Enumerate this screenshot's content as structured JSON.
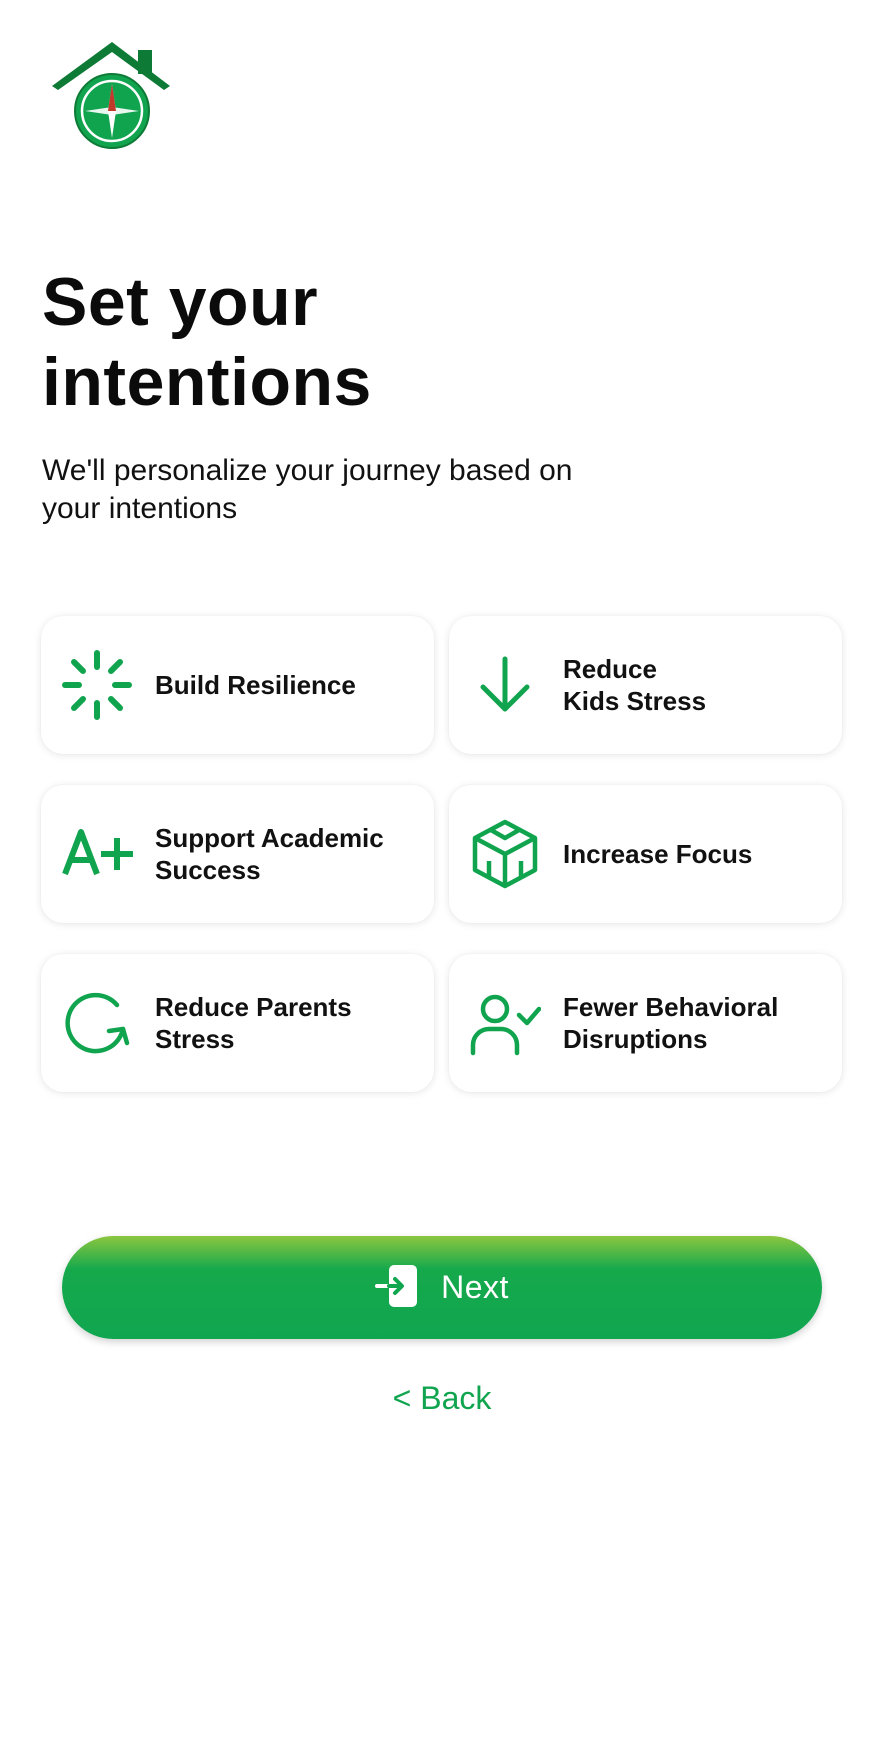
{
  "header": {
    "title": "Set your\nintentions",
    "subtitle": "We'll personalize your journey based on\nyour intentions"
  },
  "intentions": [
    {
      "label": "Build Resilience",
      "icon": "loading-burst-icon"
    },
    {
      "label": "Reduce\nKids Stress",
      "icon": "arrow-down-icon"
    },
    {
      "label": "Support Academic\nSuccess",
      "icon": "a-plus-icon"
    },
    {
      "label": "Increase Focus",
      "icon": "cube-icon"
    },
    {
      "label": "Reduce Parents\nStress",
      "icon": "circular-arrow-icon"
    },
    {
      "label": "Fewer Behavioral\nDisruptions",
      "icon": "user-check-icon"
    }
  ],
  "actions": {
    "next_label": "Next",
    "back_label": "< Back"
  },
  "colors": {
    "accent": "#11a44f",
    "gradient_top": "#8cc63f",
    "logo_dark": "#0d7a35"
  }
}
